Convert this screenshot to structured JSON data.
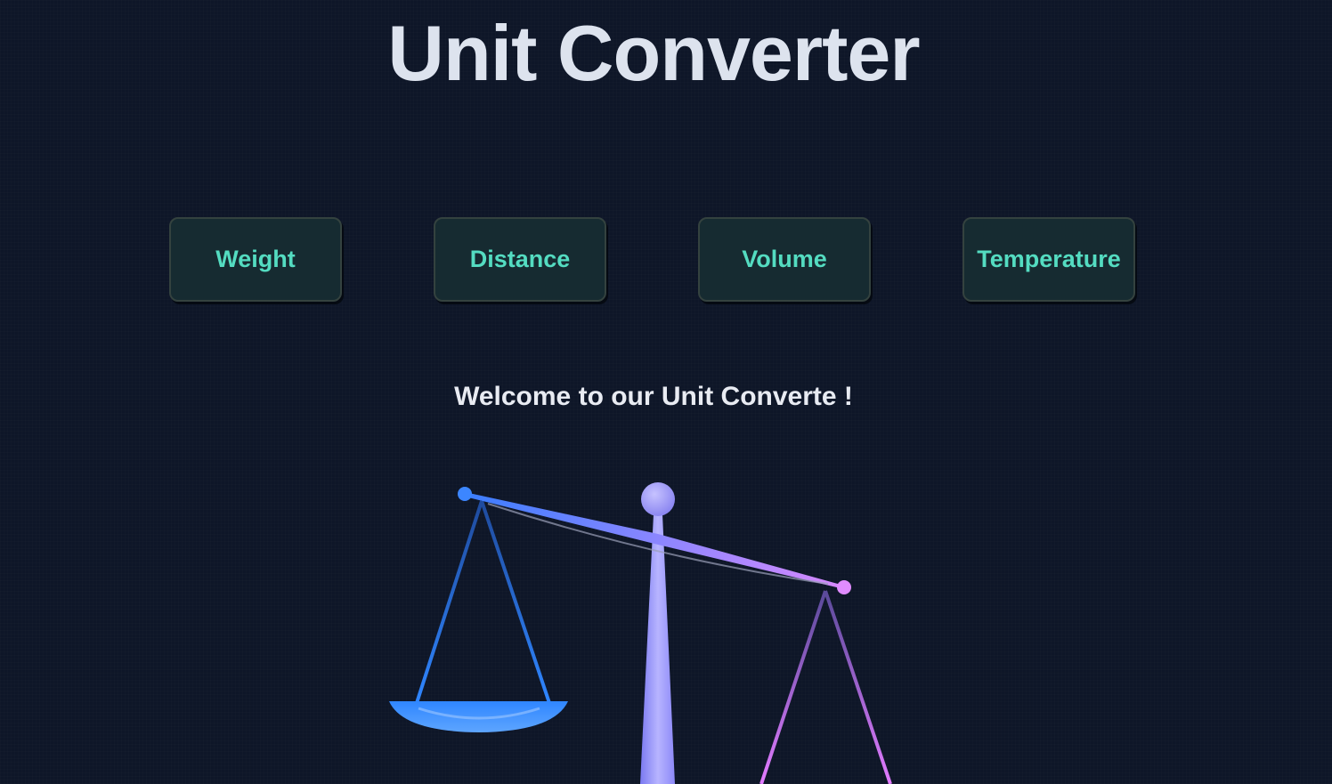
{
  "header": {
    "title": "Unit Converter"
  },
  "nav": {
    "buttons": [
      {
        "label": "Weight"
      },
      {
        "label": "Distance"
      },
      {
        "label": "Volume"
      },
      {
        "label": "Temperature"
      }
    ]
  },
  "main": {
    "welcome_text": "Welcome to our Unit Converte !"
  },
  "illustration": {
    "icon": "balance-scale-icon"
  },
  "colors": {
    "background": "#0e1628",
    "title_text": "#dde3ee",
    "button_background": "#162b31",
    "button_text": "#54dcc1",
    "scale_blue": "#2f86ff",
    "scale_violet": "#8a86ff",
    "scale_pink": "#e27bff"
  }
}
